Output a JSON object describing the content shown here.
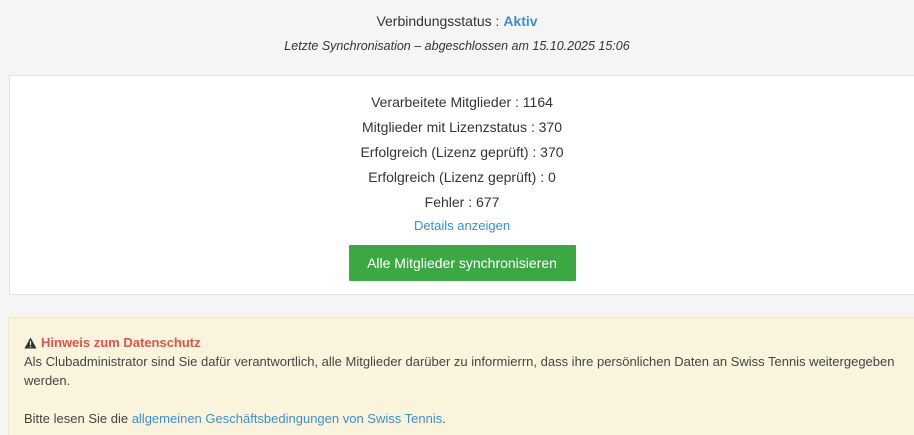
{
  "status": {
    "label": "Verbindungsstatus : ",
    "value": "Aktiv",
    "sync_text": "Letzte Synchronisation – abgeschlossen am 15.10.2025 15:06"
  },
  "stats": {
    "rows": [
      "Verarbeitete Mitglieder : 1164",
      "Mitglieder mit Lizenzstatus : 370",
      "Erfolgreich (Lizenz geprüft) : 370",
      "Erfolgreich (Lizenz geprüft) : 0",
      "Fehler : 677"
    ],
    "details_link": "Details anzeigen",
    "sync_button": "Alle Mitglieder synchronisieren"
  },
  "notice": {
    "icon": "warning-icon",
    "title": "Hinweis zum Datenschutz",
    "body": "Als Clubadministrator sind Sie dafür verantwortlich, alle Mitglieder darüber zu informierrn, dass ihre persönlichen Daten an Swiss Tennis weitergegeben werden.",
    "footer_prefix": "Bitte lesen Sie die ",
    "footer_link": "allgemeinen Geschäftsbedingungen von Swiss Tennis",
    "footer_suffix": "."
  },
  "colors": {
    "accent": "#3f8ecb",
    "button": "#3ba843",
    "warning": "#e0524e",
    "notice_bg": "#fbf4dd"
  }
}
